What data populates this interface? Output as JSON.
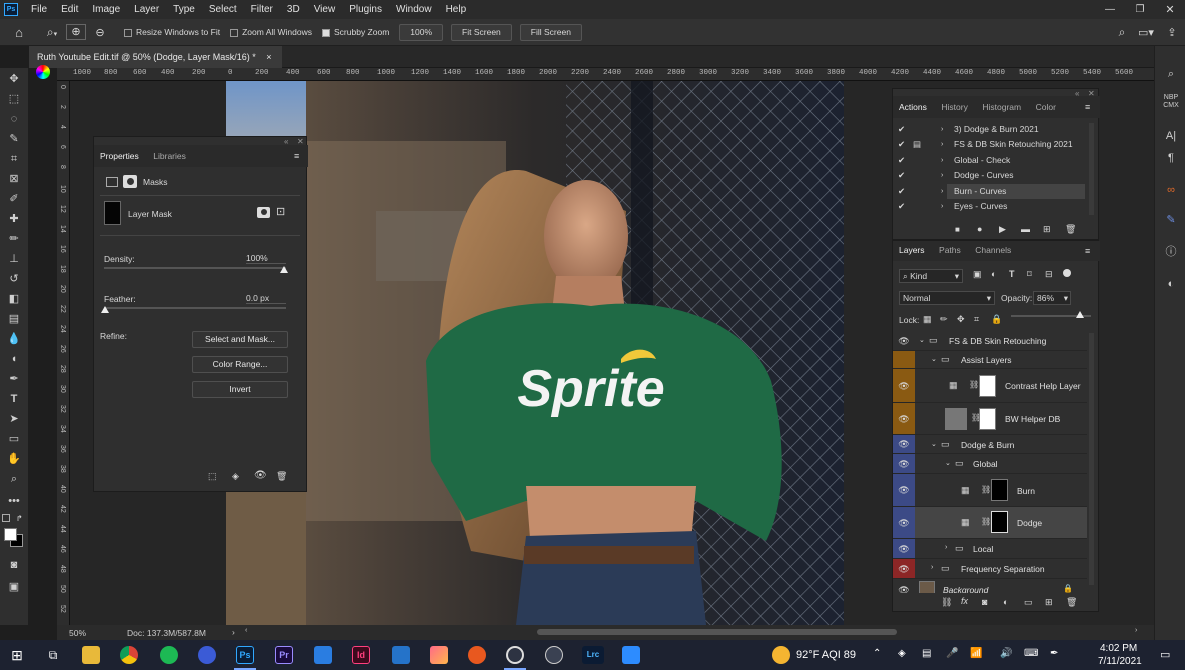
{
  "menubar": {
    "app_icon": "Ps",
    "items": [
      "File",
      "Edit",
      "Image",
      "Layer",
      "Type",
      "Select",
      "Filter",
      "3D",
      "View",
      "Plugins",
      "Window",
      "Help"
    ]
  },
  "options": {
    "resize_windows": "Resize Windows to Fit",
    "zoom_all_windows": "Zoom All Windows",
    "scrubby_zoom": "Scrubby Zoom",
    "zoom_value": "100%",
    "fit_screen": "Fit Screen",
    "fill_screen": "Fill Screen"
  },
  "document": {
    "tab_title": "Ruth Youtube Edit.tif @ 50% (Dodge, Layer Mask/16) *",
    "close": "×"
  },
  "ruler": {
    "top": [
      "1000",
      "800",
      "600",
      "400",
      "200",
      "0",
      "200",
      "400",
      "600",
      "800",
      "1000",
      "1200",
      "1400",
      "1600",
      "1800",
      "2000",
      "2200",
      "2400",
      "2600",
      "2800",
      "3000",
      "3200",
      "3400",
      "3600",
      "3800",
      "4000",
      "4200",
      "4400",
      "4600",
      "4800",
      "5000",
      "5200",
      "5400",
      "5600",
      "5800"
    ],
    "left": [
      "0",
      "2",
      "4",
      "6",
      "8",
      "10",
      "12",
      "14",
      "16",
      "18",
      "20",
      "22",
      "24",
      "26",
      "28",
      "30",
      "32",
      "34",
      "36",
      "38",
      "40",
      "42",
      "44",
      "46",
      "48",
      "50",
      "52"
    ]
  },
  "photo": {
    "shirt_text": "Sprite"
  },
  "status": {
    "zoom": "50%",
    "doc": "Doc: 137.3M/587.8M"
  },
  "properties": {
    "tab_properties": "Properties",
    "tab_libraries": "Libraries",
    "masks_label": "Masks",
    "layer_mask": "Layer Mask",
    "density_label": "Density:",
    "density_value": "100%",
    "feather_label": "Feather:",
    "feather_value": "0.0 px",
    "refine_label": "Refine:",
    "select_and_mask": "Select and Mask...",
    "color_range": "Color Range...",
    "invert": "Invert"
  },
  "actions": {
    "tabs": [
      "Actions",
      "History",
      "Histogram",
      "Color"
    ],
    "items": [
      "3) Dodge & Burn 2021",
      "FS & DB Skin Retouching 2021",
      "Global - Check",
      "Dodge - Curves",
      "Burn - Curves",
      "Eyes - Curves"
    ],
    "selected_index": 4
  },
  "layers": {
    "tabs": [
      "Layers",
      "Paths",
      "Channels"
    ],
    "kind": "Kind",
    "blend_mode": "Normal",
    "opacity_label": "Opacity:",
    "opacity_value": "86%",
    "opacity_fraction": 0.86,
    "lock_label": "Lock:",
    "rows": [
      {
        "name": "FS & DB Skin Retouching",
        "type": "group",
        "indent": 0,
        "eye": "#2f2f2f",
        "visible": true,
        "expanded": true
      },
      {
        "name": "Assist Layers",
        "type": "group",
        "indent": 1,
        "eye": "#8a5a12",
        "visible": false,
        "expanded": true
      },
      {
        "name": "Contrast Help Layer",
        "type": "adjustment",
        "indent": 2,
        "eye": "#8a5a12",
        "visible": true
      },
      {
        "name": "BW Helper DB",
        "type": "adjustment",
        "indent": 2,
        "eye": "#8a5a12",
        "visible": true
      },
      {
        "name": "Dodge & Burn",
        "type": "group",
        "indent": 1,
        "eye": "#3c4a86",
        "visible": true,
        "expanded": true
      },
      {
        "name": "Global",
        "type": "group",
        "indent": 2,
        "eye": "#3c4a86",
        "visible": true,
        "expanded": true
      },
      {
        "name": "Burn",
        "type": "adjustment",
        "indent": 3,
        "eye": "#3c4a86",
        "visible": true
      },
      {
        "name": "Dodge",
        "type": "adjustment",
        "indent": 3,
        "eye": "#3c4a86",
        "visible": true,
        "selected": true
      },
      {
        "name": "Local",
        "type": "group",
        "indent": 2,
        "eye": "#3c4a86",
        "visible": true,
        "expanded": false
      },
      {
        "name": "Frequency Separation",
        "type": "group",
        "indent": 1,
        "eye": "#8c2626",
        "visible": true,
        "expanded": false
      },
      {
        "name": "Background",
        "type": "pixel",
        "indent": 0,
        "eye": "#2f2f2f",
        "visible": true,
        "locked": true
      }
    ]
  },
  "taskbar": {
    "weather": "92°F AQI 89",
    "time": "4:02 PM",
    "date": "7/11/2021",
    "ps_label": "Ps",
    "pr_label": "Pr",
    "id_label": "Id",
    "lrc_label": "Lrc"
  },
  "colors": {
    "accent": "#2d5bd8",
    "ps_icon": "#31a8ff",
    "shirt": "#1f6a45"
  }
}
